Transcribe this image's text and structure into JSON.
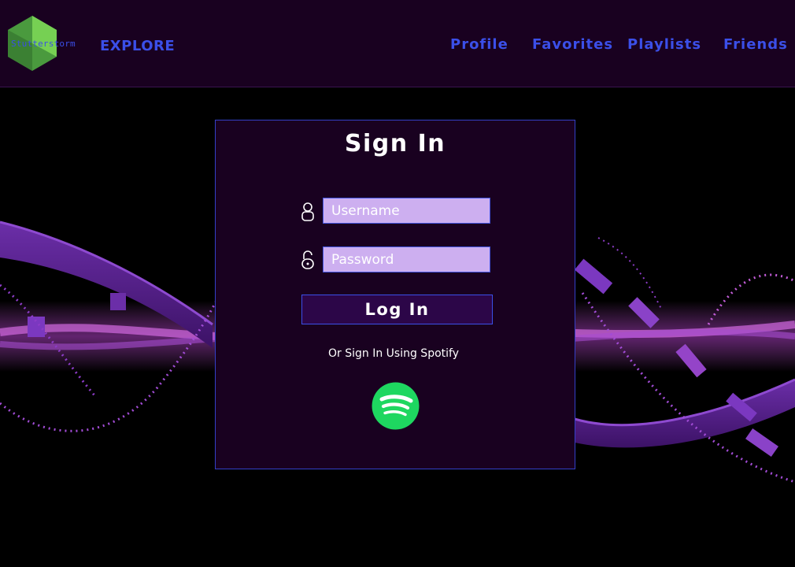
{
  "header": {
    "logo_text": "Stutterstorm",
    "explore_label": "EXPLORE",
    "nav": [
      {
        "label": "Profile"
      },
      {
        "label": "Favorites"
      },
      {
        "label": "Playlists"
      },
      {
        "label": "Friends"
      }
    ]
  },
  "signin": {
    "title": "Sign In",
    "username": {
      "placeholder": "Username",
      "value": "",
      "icon": "user-icon"
    },
    "password": {
      "placeholder": "Password",
      "value": "",
      "icon": "unlock-icon"
    },
    "login_label": "Log In",
    "alt_text": "Or Sign In Using Spotify",
    "spotify_icon": "spotify-icon"
  },
  "colors": {
    "header_bg": "#190120",
    "accent": "#3b4fe8",
    "card_bg": "#190120",
    "input_bg": "#cdaff0",
    "button_bg": "#2c0648",
    "spotify_green": "#1ed760",
    "logo_green": "#4caf50"
  }
}
